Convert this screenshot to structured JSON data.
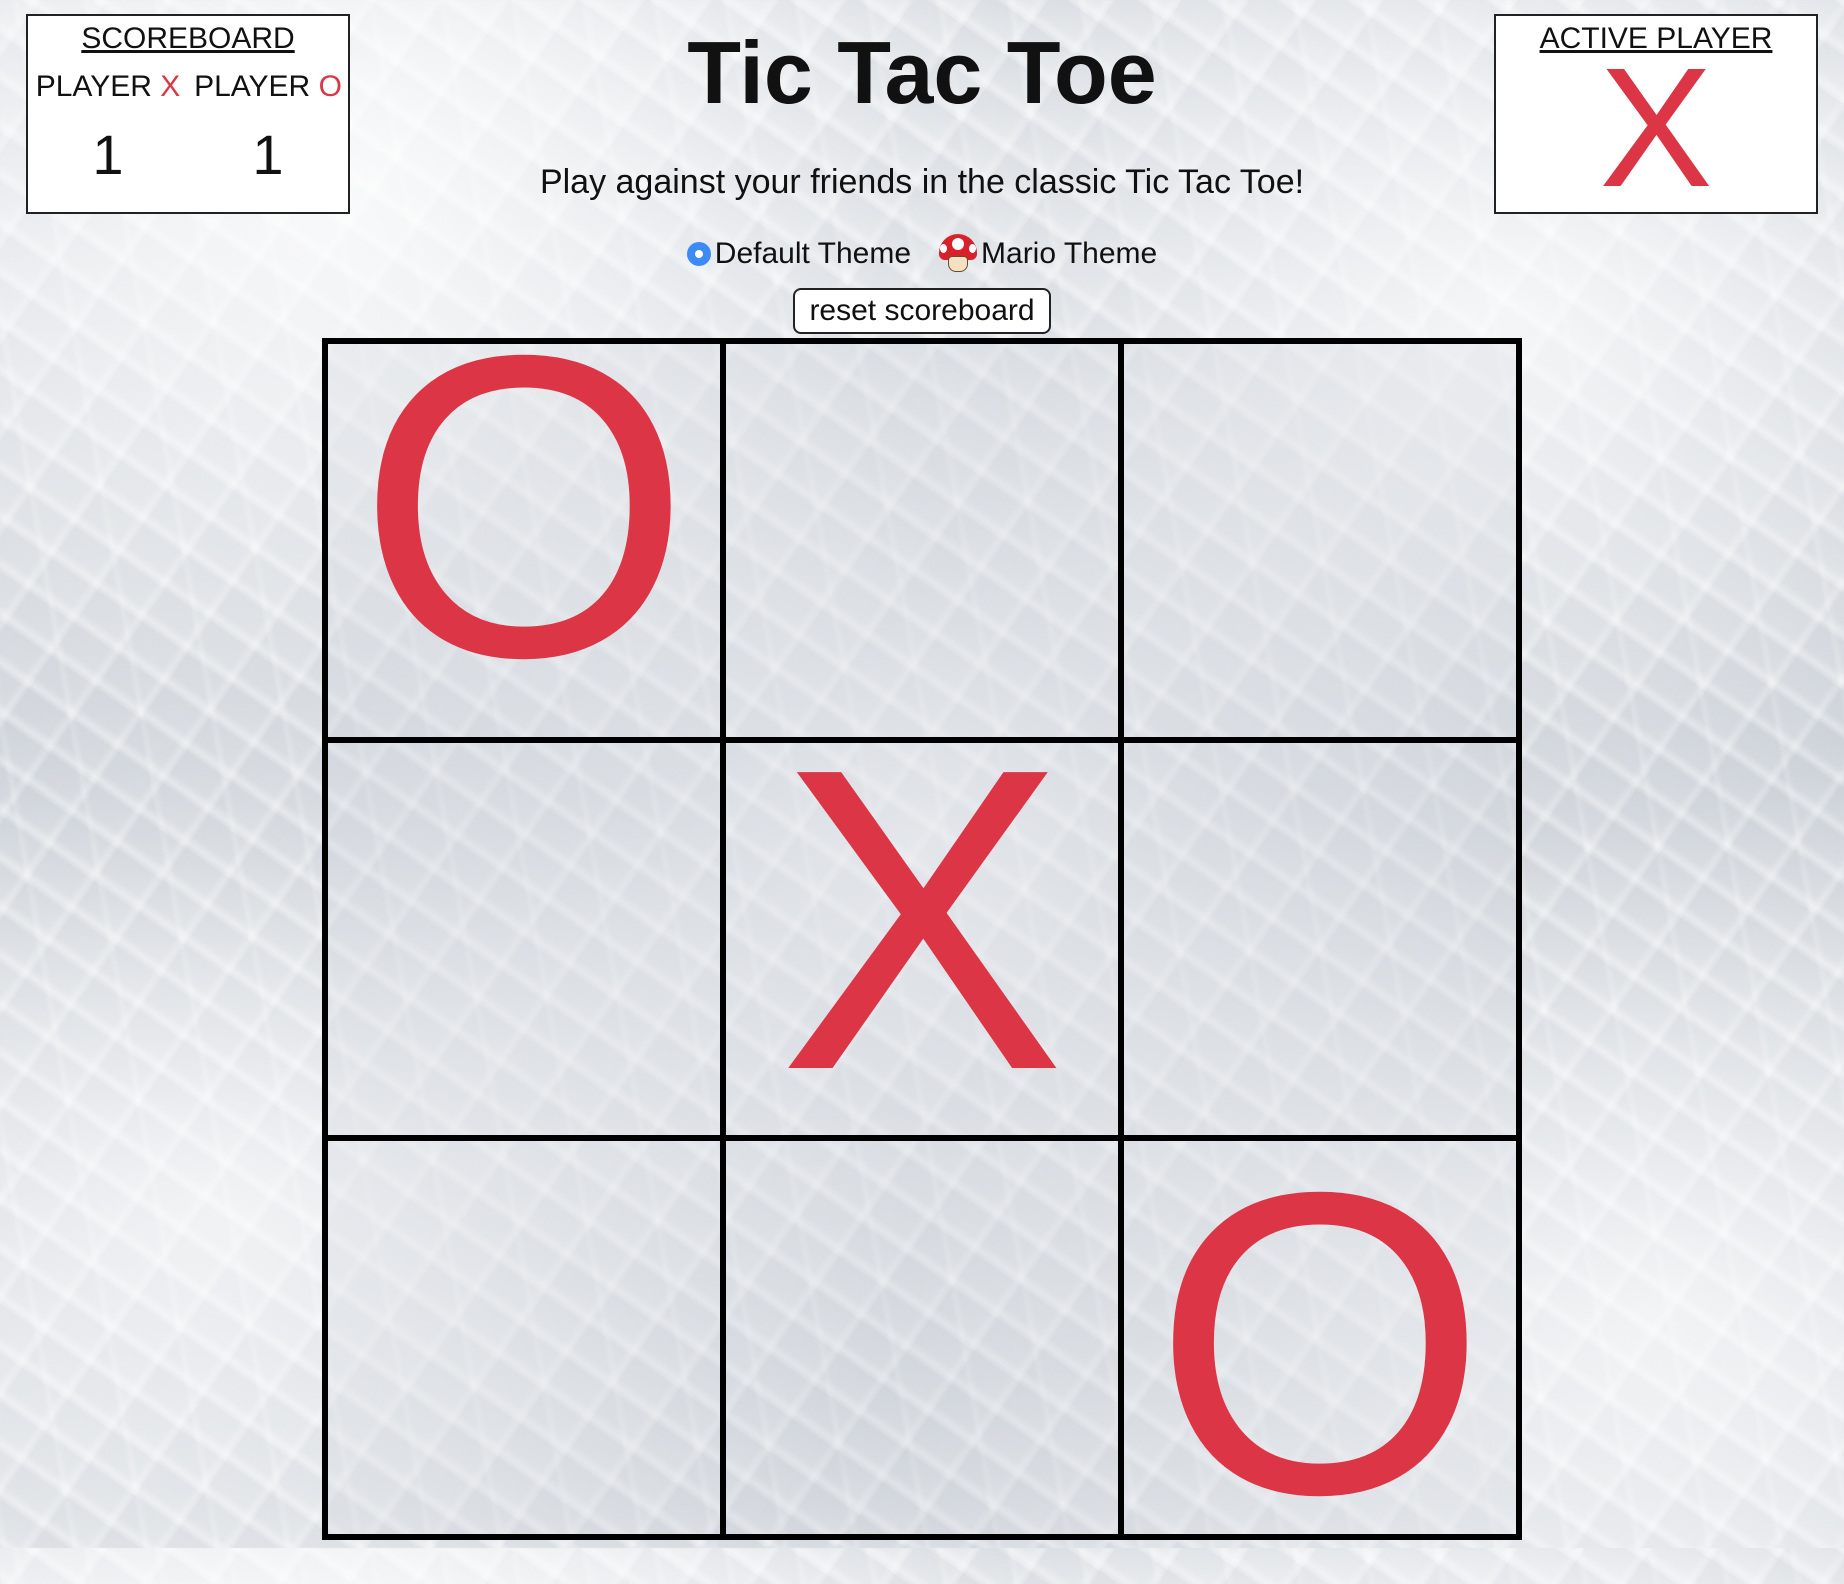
{
  "scoreboard": {
    "title": "SCOREBOARD",
    "player_x": {
      "label": "PLAYER",
      "mark": "X",
      "score": "1"
    },
    "player_o": {
      "label": "PLAYER",
      "mark": "O",
      "score": "1"
    }
  },
  "active_player": {
    "title": "ACTIVE PLAYER",
    "mark": "X"
  },
  "header": {
    "title": "Tic Tac Toe",
    "subtitle": "Play against your friends in the classic Tic Tac Toe!"
  },
  "themes": {
    "default_label": "Default Theme",
    "mario_label": "Mario Theme",
    "selected": "Default Theme"
  },
  "reset_button": {
    "label": "reset scoreboard"
  },
  "board": {
    "cells": [
      "O",
      "",
      "",
      "",
      "X",
      "",
      "",
      "",
      "O"
    ]
  },
  "colors": {
    "mark": "#dc3545",
    "radio": "#3b8af5",
    "grid": "#000000"
  },
  "icons": {
    "default_theme": "radio-selected-icon",
    "mario_theme": "mushroom-icon"
  }
}
